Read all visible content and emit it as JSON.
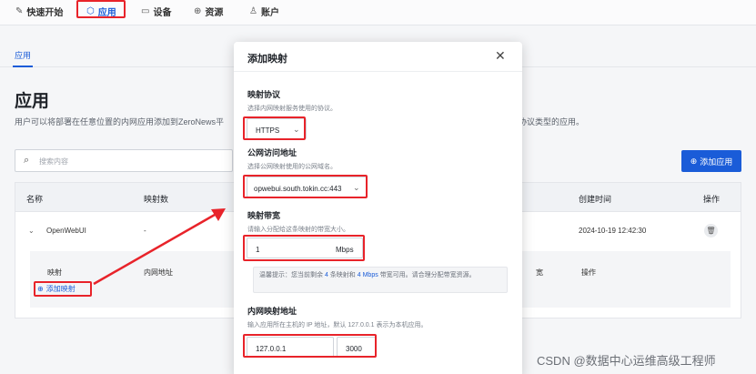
{
  "nav": {
    "items": [
      {
        "icon": "rocket-icon",
        "label": "快速开始"
      },
      {
        "icon": "cube-icon",
        "label": "应用"
      },
      {
        "icon": "laptop-icon",
        "label": "设备"
      },
      {
        "icon": "globe-icon",
        "label": "资源"
      },
      {
        "icon": "user-icon",
        "label": "账户"
      }
    ],
    "active": "应用"
  },
  "subnav": {
    "tab": "应用"
  },
  "page": {
    "title": "应用",
    "description": "用户可以将部署在任意位置的内网应用添加到ZeroNews平",
    "description_tail": "协议类型的应用。",
    "search_placeholder": "搜索内容",
    "add_button": "添加应用"
  },
  "table": {
    "headers": {
      "name": "名称",
      "mapping_count": "映射数",
      "created": "创建时间",
      "actions": "操作"
    },
    "row": {
      "name": "OpenWebUI",
      "mapping_count": "-",
      "created": "2024-10-19 12:42:30"
    },
    "subtable": {
      "col_mapping": "映射",
      "col_internal": "内网地址",
      "col_bandwidth": "宽",
      "col_actions": "操作",
      "add_mapping": "添加映射"
    }
  },
  "modal": {
    "title": "添加映射",
    "protocol": {
      "label": "映射协议",
      "help": "选择内网映射服务使用的协议。",
      "value": "HTTPS"
    },
    "domain": {
      "label": "公网访问地址",
      "help": "选择公网映射使用的公网域名。",
      "value": "opwebui.south.tokin.cc:443"
    },
    "bandwidth": {
      "label": "映射带宽",
      "help": "请输入分配给这条映射的带宽大小。",
      "value": "1",
      "unit": "Mbps",
      "notice_prefix": "温馨提示：您当前剩余",
      "notice_remaining": "4",
      "notice_mid": "条映射和",
      "notice_bandwidth": "4 Mbps",
      "notice_suffix": "带宽可用。请合理分配带宽资源。"
    },
    "internal": {
      "label": "内网映射地址",
      "help": "输入应用所在主机的 IP 地址，默认 127.0.0.1 表示为本机应用。",
      "ip": "127.0.0.1",
      "port": "3000"
    }
  },
  "watermark": "CSDN @数据中心运维高级工程师",
  "colors": {
    "accent": "#1a5cd8",
    "annotation": "#e8232a"
  }
}
